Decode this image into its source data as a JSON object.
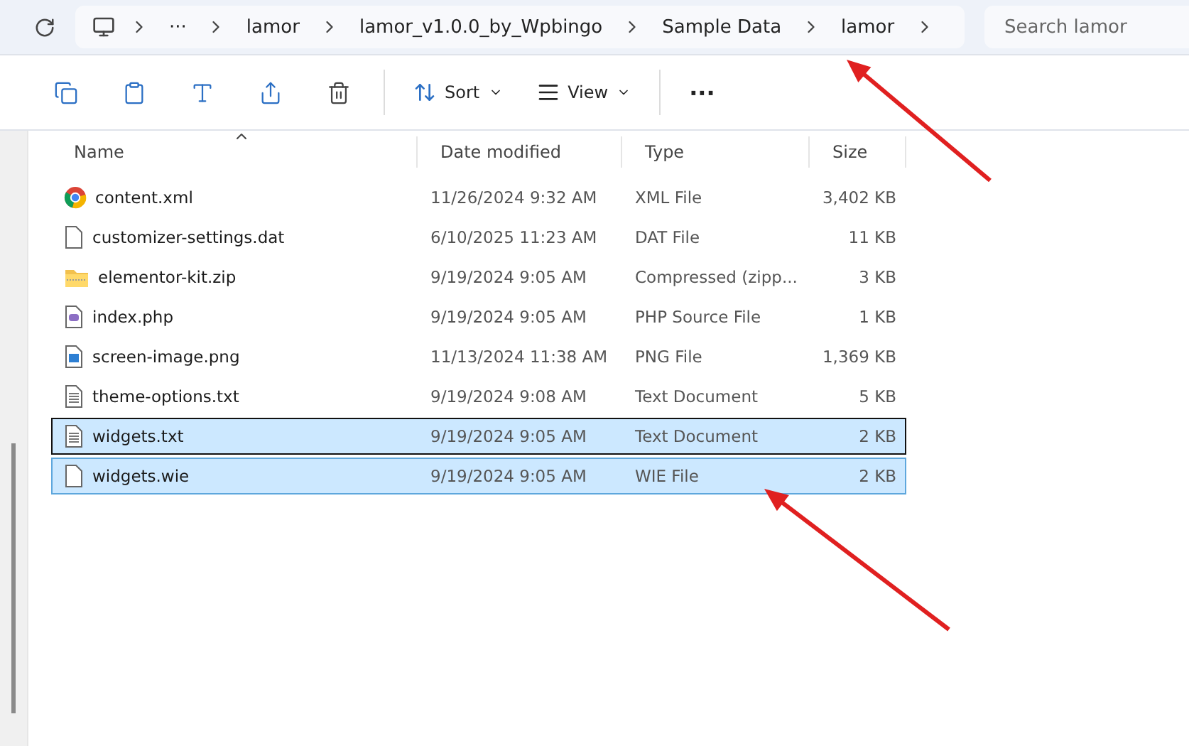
{
  "address_bar": {
    "crumbs": [
      "···",
      "lamor",
      "lamor_v1.0.0_by_Wpbingo",
      "Sample Data",
      "lamor"
    ]
  },
  "search": {
    "placeholder": "Search lamor"
  },
  "toolbar": {
    "buttons": [
      {
        "kind": "copy"
      },
      {
        "kind": "paste"
      },
      {
        "kind": "rename"
      },
      {
        "kind": "share"
      },
      {
        "kind": "delete"
      }
    ],
    "sort": "Sort",
    "view": "View",
    "more": "···"
  },
  "table": {
    "columns": [
      "Name",
      "Date modified",
      "Type",
      "Size"
    ],
    "rows": [
      {
        "kind": "browser",
        "name": "content.xml",
        "date": "11/26/2024 9:32 AM",
        "type": "XML File",
        "size": "3,402 KB",
        "selected": false,
        "focused": false
      },
      {
        "kind": "blank",
        "name": "customizer-settings.dat",
        "date": "6/10/2025 11:23 AM",
        "type": "DAT File",
        "size": "11 KB",
        "selected": false,
        "focused": false
      },
      {
        "kind": "zip",
        "name": "elementor-kit.zip",
        "date": "9/19/2024 9:05 AM",
        "type": "Compressed (zipp...",
        "size": "3 KB",
        "selected": false,
        "focused": false
      },
      {
        "kind": "php",
        "name": "index.php",
        "date": "9/19/2024 9:05 AM",
        "type": "PHP Source File",
        "size": "1 KB",
        "selected": false,
        "focused": false
      },
      {
        "kind": "image",
        "name": "screen-image.png",
        "date": "11/13/2024 11:38 AM",
        "type": "PNG File",
        "size": "1,369 KB",
        "selected": false,
        "focused": false
      },
      {
        "kind": "text",
        "name": "theme-options.txt",
        "date": "9/19/2024 9:08 AM",
        "type": "Text Document",
        "size": "5 KB",
        "selected": false,
        "focused": false
      },
      {
        "kind": "text",
        "name": "widgets.txt",
        "date": "9/19/2024 9:05 AM",
        "type": "Text Document",
        "size": "2 KB",
        "selected": true,
        "focused": true
      },
      {
        "kind": "blank",
        "name": "widgets.wie",
        "date": "9/19/2024 9:05 AM",
        "type": "WIE File",
        "size": "2 KB",
        "selected": true,
        "focused": false
      }
    ]
  },
  "annotations": [
    {
      "kind": "arrow"
    },
    {
      "kind": "arrow"
    }
  ]
}
